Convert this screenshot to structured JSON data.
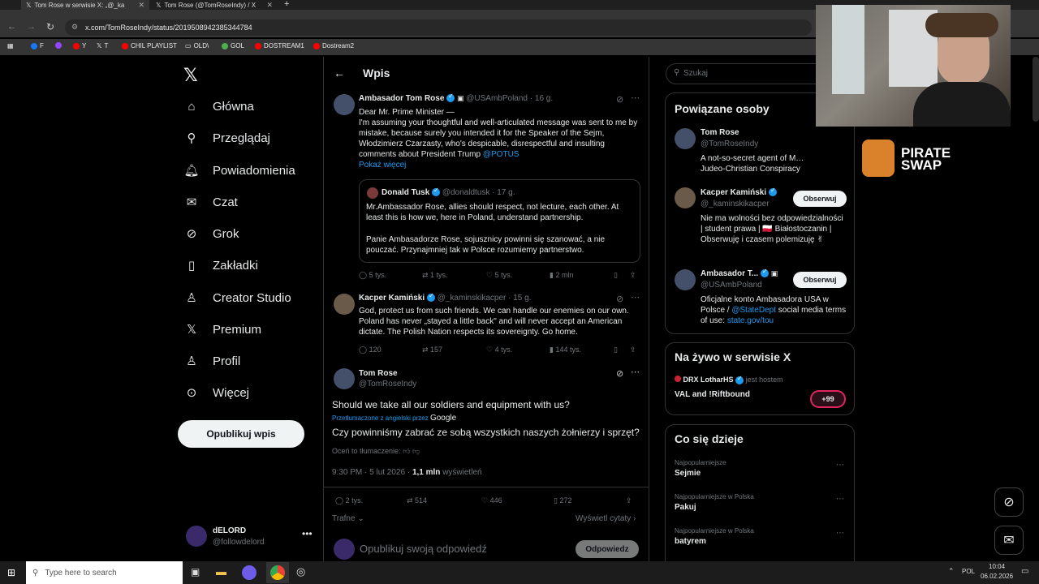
{
  "browser": {
    "tabs": [
      {
        "title": "Tom Rose w serwisie X: „@_ka"
      },
      {
        "title": "Tom Rose (@TomRoseIndy) / X"
      }
    ],
    "url": "x.com/TomRoseIndy/status/2019508942385344784",
    "bookmarks": [
      "F",
      "Y",
      "T",
      "CHIL PLAYLIST",
      "OLD\\",
      "GOL",
      "DOSTREAM1",
      "Dostream2"
    ]
  },
  "nav": {
    "items": [
      "Główna",
      "Przeglądaj",
      "Powiadomienia",
      "Czat",
      "Grok",
      "Zakładki",
      "Creator Studio",
      "Premium",
      "Profil",
      "Więcej"
    ],
    "post_button": "Opublikuj wpis",
    "account": {
      "name": "dELORD",
      "handle": "@followdelord"
    }
  },
  "header": {
    "title": "Wpis"
  },
  "tweet1": {
    "name": "Ambasador Tom Rose",
    "handle": "@USAmbPoland · 16 g.",
    "line1": "Dear Mr. Prime Minister —",
    "body": "I'm assuming your thoughtful and well-articulated message was sent to me by mistake, because surely you intended it for the Speaker of the Sejm, Włodzimierz Czarzasty, who's despicable, disrespectful and insulting comments about President Trump",
    "mention": "@POTUS",
    "show_more": "Pokaż więcej",
    "quote": {
      "name": "Donald Tusk",
      "handle": "@donaldtusk · 17 g.",
      "p1": "Mr.Ambassador Rose, allies should respect, not lecture, each other. At least this is how we, here in Poland, understand partnership.",
      "p2": "Panie Ambasadorze Rose, sojusznicy powinni się szanować, a nie pouczać. Przynajmniej tak w Polsce rozumiemy partnerstwo."
    },
    "stats": {
      "replies": "5 tys.",
      "reposts": "1 tys.",
      "likes": "5 tys.",
      "views": "2 mln"
    }
  },
  "tweet2": {
    "name": "Kacper Kamiński",
    "handle": "@_kaminskikacper · 15 g.",
    "body": "God, protect us from such friends. We can handle our enemies on our own. Poland has never „stayed a little back\" and will never accept an American dictate. The Polish Nation respects its sovereignty. Go home.",
    "stats": {
      "replies": "120",
      "reposts": "157",
      "likes": "4 tys.",
      "views": "144 tys."
    }
  },
  "main_tweet": {
    "name": "Tom Rose",
    "handle": "@TomRoseIndy",
    "body": "Should we take all our soldiers and equipment with us?",
    "translated_by": "Przetłumaczone z angielski przez",
    "google": "Google",
    "translation": "Czy powinniśmy zabrać ze sobą wszystkich naszych żołnierzy i sprzęt?",
    "rate": "Oceń to tłumaczenie:",
    "time": "9:30 PM · 5 lut 2026 ·",
    "views_count": "1,1 mln",
    "views_label": "wyświetleń",
    "stats": {
      "replies": "2 tys.",
      "reposts": "514",
      "likes": "446",
      "bookmarks": "272"
    },
    "sort": "Trafne",
    "show_quotes": "Wyświetl cytaty",
    "reply_placeholder": "Opublikuj swoją odpowiedź",
    "reply_button": "Odpowiedz"
  },
  "search": {
    "placeholder": "Szukaj"
  },
  "related": {
    "title": "Powiązane osoby",
    "people": [
      {
        "name": "Tom Rose",
        "handle": "@TomRoseIndy",
        "bio": "A not-so-secret agent of M… Judeo-Christian Conspiracy",
        "button": ""
      },
      {
        "name": "Kacper Kamiński",
        "handle": "@_kaminskikacper",
        "bio": "Nie ma wolności bez odpowiedzialności | student prawa | 🇵🇱 Białostoczanin | Obserwuję i czasem polemizuję ✌",
        "button": "Obserwuj"
      },
      {
        "name": "Ambasador T...",
        "handle": "@USAmbPoland",
        "bio": "Oficjalne konto Ambasadora USA w Polsce /",
        "bio_link": "@StateDept",
        "bio_end": "social media terms of use:",
        "bio_url": "state.gov/tou",
        "button": "Obserwuj"
      }
    ]
  },
  "live": {
    "title": "Na żywo w serwisie X",
    "host": "DRX LotharHS",
    "host_suffix": "jest hostem",
    "stream": "VAL and !Riftbound",
    "count": "+99"
  },
  "trends": {
    "title": "Co się dzieje",
    "items": [
      {
        "meta": "Najpopularniejsze",
        "name": "Sejmie"
      },
      {
        "meta": "Najpopularniejsze w Polska",
        "name": "Pakuj"
      },
      {
        "meta": "Najpopularniejsze w Polska",
        "name": "batyrem"
      }
    ]
  },
  "overlay": {
    "brand_line1": "PIRATE",
    "brand_line2": "SWAP"
  },
  "taskbar": {
    "search": "Type here to search",
    "lang": "POL",
    "time": "10:04",
    "date": "06.02.2026"
  }
}
